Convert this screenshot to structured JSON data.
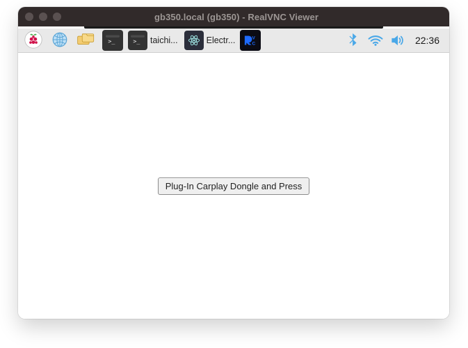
{
  "window": {
    "title": "gb350.local (gb350) - RealVNC Viewer"
  },
  "taskbar": {
    "tasks": [
      {
        "icon": "terminal",
        "label": "taichi..."
      },
      {
        "icon": "electron",
        "label": "Electr..."
      }
    ]
  },
  "tray": {
    "clock": "22:36"
  },
  "main": {
    "button_label": "Plug-In Carplay Dongle and Press"
  }
}
